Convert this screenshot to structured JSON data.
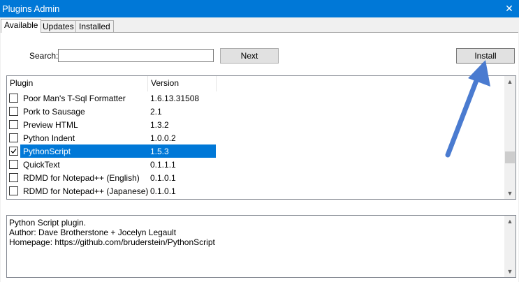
{
  "window": {
    "title": "Plugins Admin",
    "close_glyph": "✕"
  },
  "tabs": [
    {
      "label": "Available",
      "active": true
    },
    {
      "label": "Updates",
      "active": false
    },
    {
      "label": "Installed",
      "active": false
    }
  ],
  "search": {
    "label": "Search:",
    "value": "",
    "placeholder": ""
  },
  "buttons": {
    "next": "Next",
    "install": "Install"
  },
  "list": {
    "columns": [
      "Plugin",
      "Version"
    ],
    "rows": [
      {
        "name": "Poor Man's T-Sql Formatter",
        "version": "1.6.13.31508",
        "checked": false,
        "selected": false
      },
      {
        "name": "Pork to Sausage",
        "version": "2.1",
        "checked": false,
        "selected": false
      },
      {
        "name": "Preview HTML",
        "version": "1.3.2",
        "checked": false,
        "selected": false
      },
      {
        "name": "Python Indent",
        "version": "1.0.0.2",
        "checked": false,
        "selected": false
      },
      {
        "name": "PythonScript",
        "version": "1.5.3",
        "checked": true,
        "selected": true
      },
      {
        "name": "QuickText",
        "version": "0.1.1.1",
        "checked": false,
        "selected": false
      },
      {
        "name": "RDMD for Notepad++ (English)",
        "version": "0.1.0.1",
        "checked": false,
        "selected": false
      },
      {
        "name": "RDMD for Notepad++ (Japanese)",
        "version": "0.1.0.1",
        "checked": false,
        "selected": false
      }
    ]
  },
  "description": {
    "lines": [
      "Python Script plugin.",
      "Author: Dave Brotherstone + Jocelyn Legault",
      "Homepage: https://github.com/bruderstein/PythonScript"
    ]
  },
  "icons": {
    "scroll_up": "scroll-up-arrow-icon",
    "scroll_down": "scroll-down-arrow-icon",
    "check": "checkmark-icon",
    "annotation": "pointer-arrow-icon"
  },
  "colors": {
    "titlebar": "#0078d7",
    "selection": "#0078d7",
    "annotation_arrow": "#4a7bd0"
  }
}
